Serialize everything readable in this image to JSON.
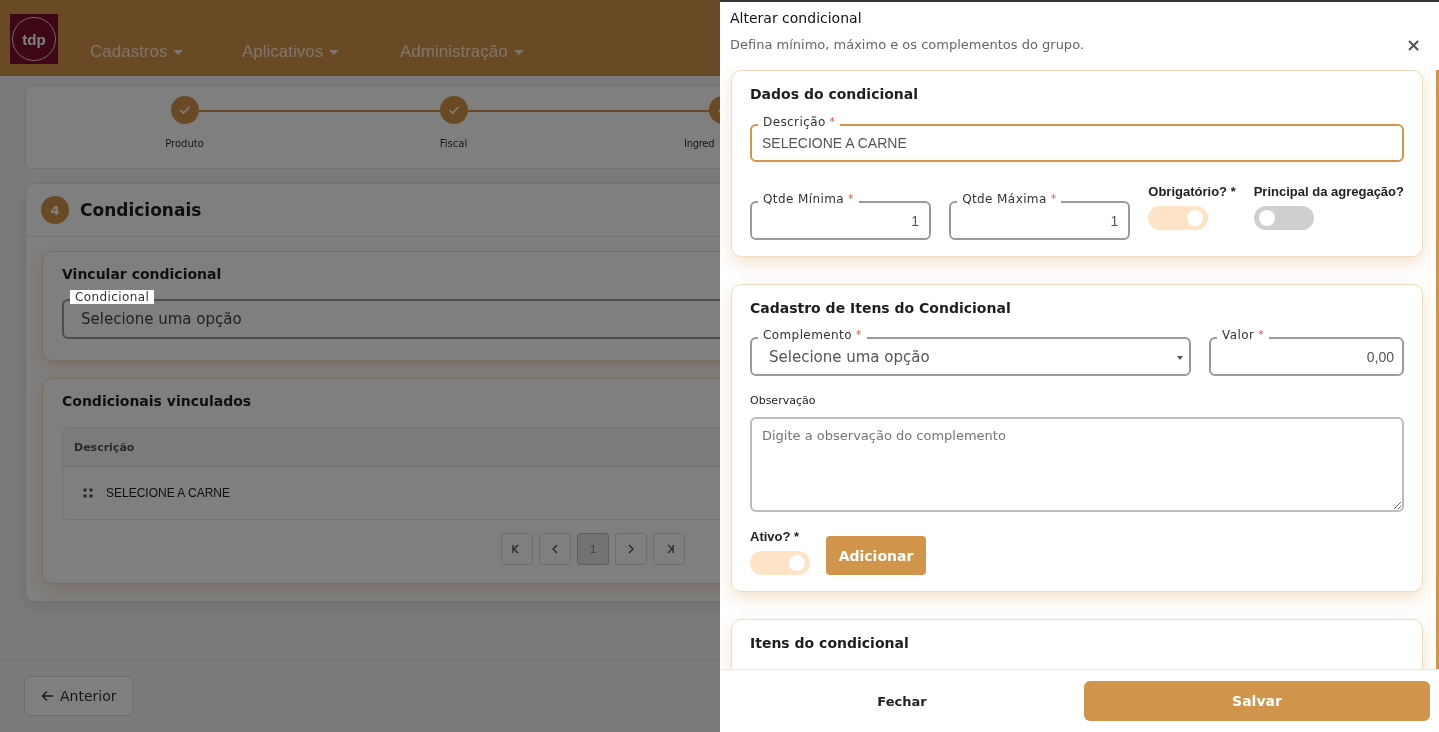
{
  "header": {
    "logo_text": "tdp",
    "nav": [
      {
        "label": "Cadastros"
      },
      {
        "label": "Aplicativos"
      },
      {
        "label": "Administração"
      }
    ]
  },
  "stepper": {
    "steps": [
      {
        "label": "Produto",
        "done": true
      },
      {
        "label": "Fiscal",
        "done": true
      },
      {
        "label": "Ingred",
        "done": true
      }
    ]
  },
  "section": {
    "number": "4",
    "title": "Condicionais"
  },
  "link_card": {
    "title": "Vincular condicional",
    "field": {
      "label": "Condicional",
      "value": "Selecione uma opção"
    }
  },
  "linked_card": {
    "title": "Condicionais vinculados",
    "table": {
      "columns": [
        "Descrição"
      ],
      "rows": [
        [
          "SELECIONE A CARNE"
        ]
      ]
    },
    "pagination": [
      {
        "kind": "first"
      },
      {
        "kind": "prev"
      },
      {
        "kind": "page",
        "label": "1",
        "selected": true
      },
      {
        "kind": "next"
      },
      {
        "kind": "last"
      }
    ]
  },
  "back_button": {
    "label": "Anterior"
  },
  "drawer": {
    "title": "Alterar condicional",
    "subtitle": "Defina mínimo, máximo e os complementos do grupo.",
    "close": "×",
    "details": {
      "title": "Dados do condicional",
      "description": {
        "label": "Descrição",
        "mark": "*",
        "value": "SELECIONE A CARNE",
        "focused": true
      },
      "quantities": [
        {
          "label": "Qtde Mínima",
          "mark": "*",
          "value": "1"
        },
        {
          "label": "Qtde Máxima",
          "mark": "*",
          "value": "1"
        }
      ],
      "toggles": [
        {
          "label": "Obrigatório? *",
          "on": true
        },
        {
          "label": "Principal da agregação?",
          "on": false
        }
      ]
    },
    "items_form": {
      "title": "Cadastro de Itens do Condicional",
      "complement": {
        "label": "Complemento",
        "mark": "*",
        "value": "Selecione uma opção"
      },
      "price": {
        "label": "Valor",
        "mark": "*",
        "value": "0,00"
      },
      "note": {
        "label": "Observação",
        "placeholder": "Digite a observação do complemento"
      },
      "active": {
        "label": "Ativo? *",
        "on": true
      },
      "add_button": "Adicionar"
    },
    "items_list": {
      "title": "Itens do condicional"
    },
    "footer": {
      "close_button": "Fechar",
      "save_button": "Salvar"
    }
  }
}
